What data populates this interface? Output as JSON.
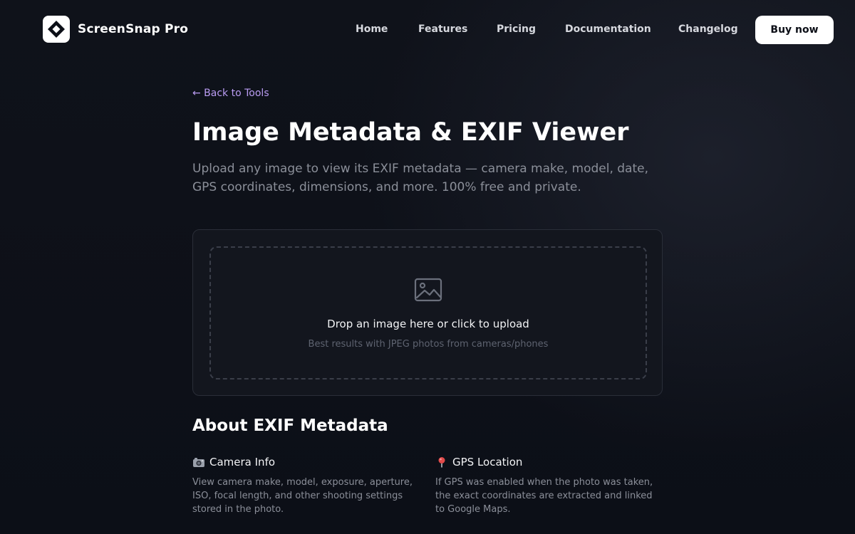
{
  "brand": {
    "name": "ScreenSnap Pro"
  },
  "nav": {
    "links": [
      "Home",
      "Features",
      "Pricing",
      "Documentation",
      "Changelog"
    ],
    "cta": "Buy now"
  },
  "back_link": "← Back to Tools",
  "page": {
    "title": "Image Metadata & EXIF Viewer",
    "subtitle": "Upload any image to view its EXIF metadata — camera make, model, date, GPS coordinates, dimensions, and more. 100% free and private."
  },
  "upload": {
    "icon": "image-icon",
    "title": "Drop an image here or click to upload",
    "hint": "Best results with JPEG photos from cameras/phones"
  },
  "about": {
    "title": "About EXIF Metadata",
    "features": [
      {
        "icon": "camera-icon",
        "title": "Camera Info",
        "desc": "View camera make, model, exposure, aperture, ISO, focal length, and other shooting settings stored in the photo."
      },
      {
        "icon": "pin-icon",
        "title": "GPS Location",
        "desc": "If GPS was enabled when the photo was taken, the exact coordinates are extracted and linked to Google Maps."
      }
    ]
  },
  "colors": {
    "background": "#0f121a",
    "accent_link": "#b99cf2",
    "muted_text": "#8b8f99",
    "card": "#13161e"
  }
}
